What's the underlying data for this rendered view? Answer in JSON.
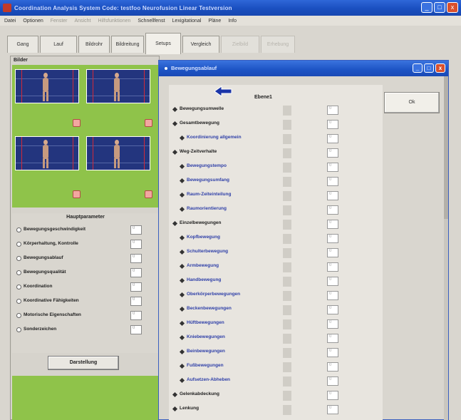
{
  "window": {
    "title": "Coordination Analysis System  Code: testfoo  Neurofusion  Linear  Testversion",
    "buttons": [
      "_",
      "□",
      "x"
    ]
  },
  "menu": {
    "items": [
      "Datei",
      "Optionen",
      "Fenster",
      "Ansicht",
      "Hilfsfunktionen",
      "Schnellfenst",
      "Lexigitational",
      "Pläne",
      "Info"
    ]
  },
  "tabs": [
    {
      "label": "Gang",
      "state": "normal"
    },
    {
      "label": "Lauf",
      "state": "normal"
    },
    {
      "label": "Bildrohr",
      "state": "normal"
    },
    {
      "label": "Bildreitung",
      "state": "normal"
    },
    {
      "label": "Setups",
      "state": "active"
    },
    {
      "label": "Vergleich",
      "state": "normal"
    },
    {
      "label": "Zielbild",
      "state": "disabled"
    },
    {
      "label": "Erhebung",
      "state": "disabled"
    }
  ],
  "left_panel": {
    "bilder_label": "Bilder",
    "param_title": "Hauptparameter",
    "params": [
      {
        "label": "Bewegungsgeschwindigkeit",
        "value": "0"
      },
      {
        "label": "Körperhaltung, Kontrolle",
        "value": "0"
      },
      {
        "label": "Bewegungsablauf",
        "value": "0"
      },
      {
        "label": "Bewegungsqualität",
        "value": "0"
      },
      {
        "label": "Koordination",
        "value": "0"
      },
      {
        "label": "Koordinative Fähigkeiten",
        "value": "0"
      },
      {
        "label": "Motorische Eigenschaften",
        "value": "0"
      },
      {
        "label": "Sonderzeichen",
        "value": "0"
      }
    ],
    "darstellung_label": "Darstellung"
  },
  "dialog": {
    "title": "Bewegungsablauf",
    "ebene_header": "Ebene1",
    "ok_label": "Ok",
    "items": [
      {
        "label": "Bewegungsumwelle",
        "level": 1,
        "value": "0"
      },
      {
        "label": "Gesamtbewegung",
        "level": 1,
        "value": "0"
      },
      {
        "label": "Koordinierung allgemein",
        "level": 2,
        "value": "0"
      },
      {
        "label": "Weg-Zeitverhalte",
        "level": 1,
        "value": "0"
      },
      {
        "label": "Bewegungstempo",
        "level": 2,
        "value": "0"
      },
      {
        "label": "Bewegungsumfang",
        "level": 2,
        "value": "0"
      },
      {
        "label": "Raum-Zeiteinteilung",
        "level": 2,
        "value": "0"
      },
      {
        "label": "Raumorientierung",
        "level": 2,
        "value": "0"
      },
      {
        "label": "Einzelbewegungen",
        "level": 1,
        "value": "0"
      },
      {
        "label": "Kopfbewegung",
        "level": 2,
        "value": "0"
      },
      {
        "label": "Schulterbewegung",
        "level": 2,
        "value": "0"
      },
      {
        "label": "Armbewegung",
        "level": 2,
        "value": "0"
      },
      {
        "label": "Handbewegung",
        "level": 2,
        "value": "0"
      },
      {
        "label": "Oberkörperbewegungen",
        "level": 2,
        "value": "0"
      },
      {
        "label": "Beckenbewegungen",
        "level": 2,
        "value": "0"
      },
      {
        "label": "Hüftbewegungen",
        "level": 2,
        "value": "0"
      },
      {
        "label": "Kniebewegungen",
        "level": 2,
        "value": "0"
      },
      {
        "label": "Beinbewegungen",
        "level": 2,
        "value": "0"
      },
      {
        "label": "Fußbewegungen",
        "level": 2,
        "value": "0"
      },
      {
        "label": "Aufsetzen-Abheben",
        "level": 2,
        "value": "0"
      },
      {
        "label": "Gelenkabdeckung",
        "level": 1,
        "value": "0"
      },
      {
        "label": "Lenkung",
        "level": 1,
        "value": "0"
      }
    ]
  },
  "colors": {
    "titlebar": "#1a4fc0",
    "video_bg": "#8fc34a",
    "video_frame": "#23357e",
    "close": "#d9502d",
    "sublabel": "#2e3fa8"
  },
  "icons": [
    "app-icon",
    "minimize-icon",
    "maximize-icon",
    "close-icon",
    "back-arrow-icon",
    "record-icon"
  ]
}
